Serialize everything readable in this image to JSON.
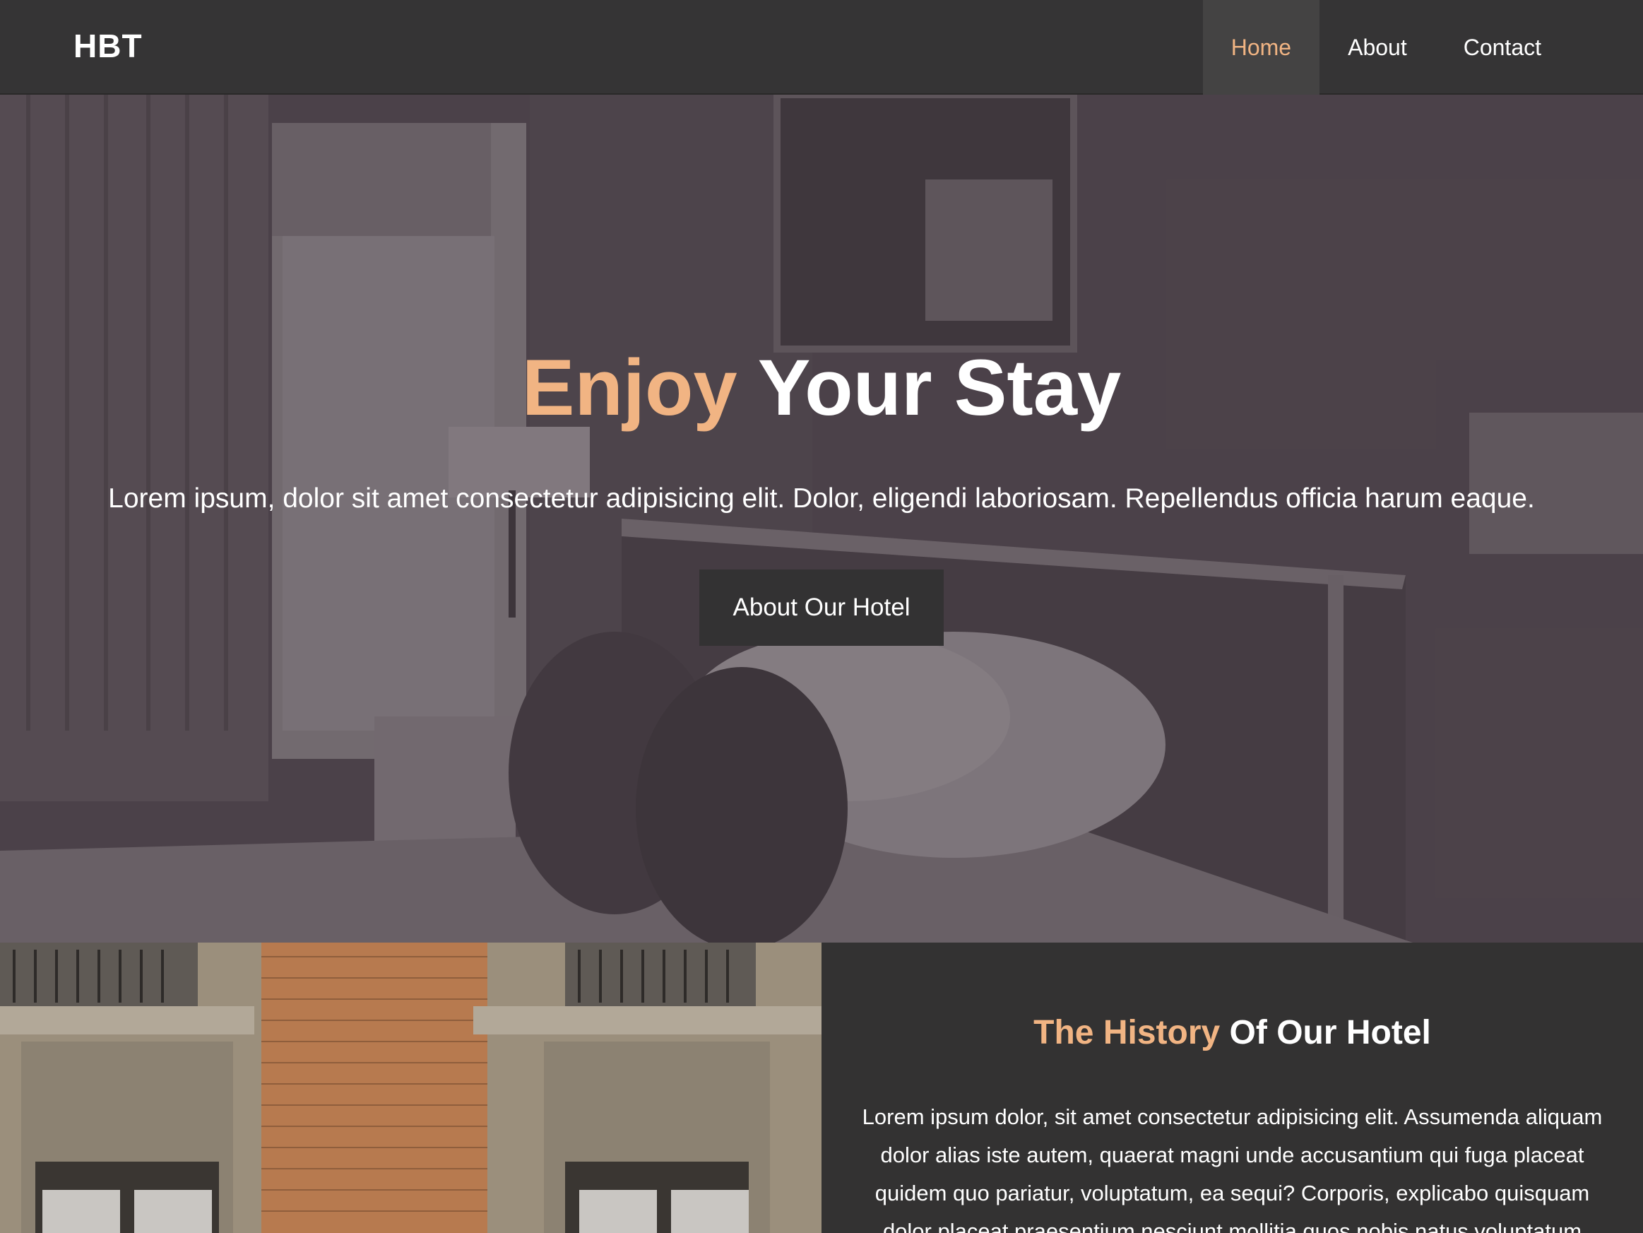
{
  "navbar": {
    "brand": "HBT",
    "items": [
      {
        "label": "Home",
        "active": true
      },
      {
        "label": "About",
        "active": false
      },
      {
        "label": "Contact",
        "active": false
      }
    ]
  },
  "hero": {
    "title_accent": "Enjoy",
    "title_rest": "Your Stay",
    "text": "Lorem ipsum, dolor sit amet consectetur adipisicing elit. Dolor, eligendi laboriosam. Repellendus officia harum eaque.",
    "button_label": "About Our Hotel",
    "image": "hotel-room-photo"
  },
  "history": {
    "title_accent": "The History",
    "title_rest": "Of Our Hotel",
    "text": "Lorem ipsum dolor, sit amet consectetur adipisicing elit. Assumenda aliquam dolor alias iste autem, quaerat magni unde accusantium qui fuga placeat quidem quo pariatur, voluptatum, ea sequi? Corporis, explicabo quisquam dolor placeat praesentium nesciunt mollitia quos nobis natus voluptatum",
    "image": "hotel-building-facade-photo"
  },
  "colors": {
    "accent": "#f1b483",
    "navbar_bg": "#353435",
    "section_bg": "#333232",
    "button_bg": "#333233"
  }
}
